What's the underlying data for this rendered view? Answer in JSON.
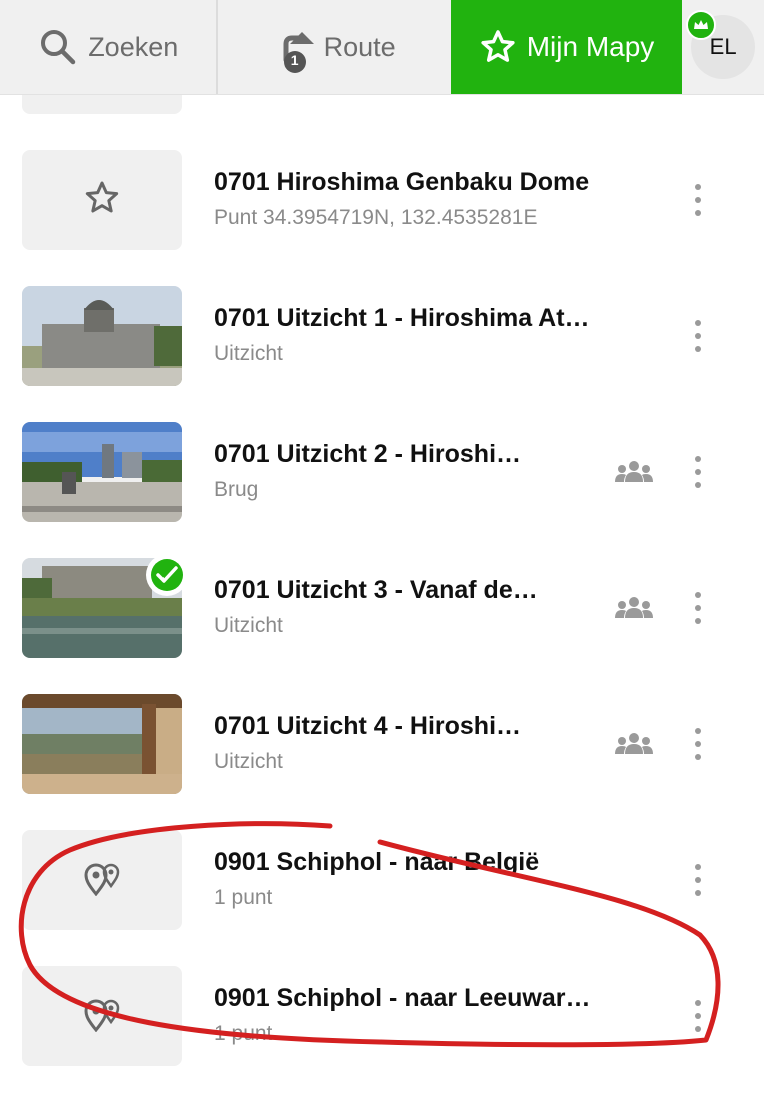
{
  "topbar": {
    "search_label": "Zoeken",
    "route_label": "Route",
    "route_badge": "1",
    "mymapy_label": "Mijn Mapy",
    "avatar_initials": "EL",
    "accent_color": "#21b30f"
  },
  "items": [
    {
      "title": "0701 Hiroshima Genbaku Dome",
      "subtitle": "Punt 34.3954719N, 132.4535281E",
      "thumb_icon": "star-outline-icon",
      "shared": false,
      "checked": false
    },
    {
      "title": "0701 Uitzicht 1 - Hiroshima At…",
      "subtitle": "Uitzicht",
      "thumb_icon": "photo-dome-ruins",
      "shared": false,
      "checked": false
    },
    {
      "title": "0701 Uitzicht 2 - Hiroshi…",
      "subtitle": "Brug",
      "thumb_icon": "photo-bridge-park",
      "shared": true,
      "checked": false
    },
    {
      "title": "0701 Uitzicht 3 - Vanaf de…",
      "subtitle": "Uitzicht",
      "thumb_icon": "photo-river-view",
      "shared": true,
      "checked": true
    },
    {
      "title": "0701 Uitzicht 4 - Hiroshi…",
      "subtitle": "Uitzicht",
      "thumb_icon": "photo-terrace-city",
      "shared": true,
      "checked": false
    },
    {
      "title": "0901 Schiphol - naar België",
      "subtitle": "1 punt",
      "thumb_icon": "multi-pin-icon",
      "shared": false,
      "checked": false
    },
    {
      "title": "0901 Schiphol - naar Leeuwar…",
      "subtitle": "1 punt",
      "thumb_icon": "multi-pin-icon",
      "shared": false,
      "checked": false
    }
  ],
  "annotation_color": "#d42020"
}
